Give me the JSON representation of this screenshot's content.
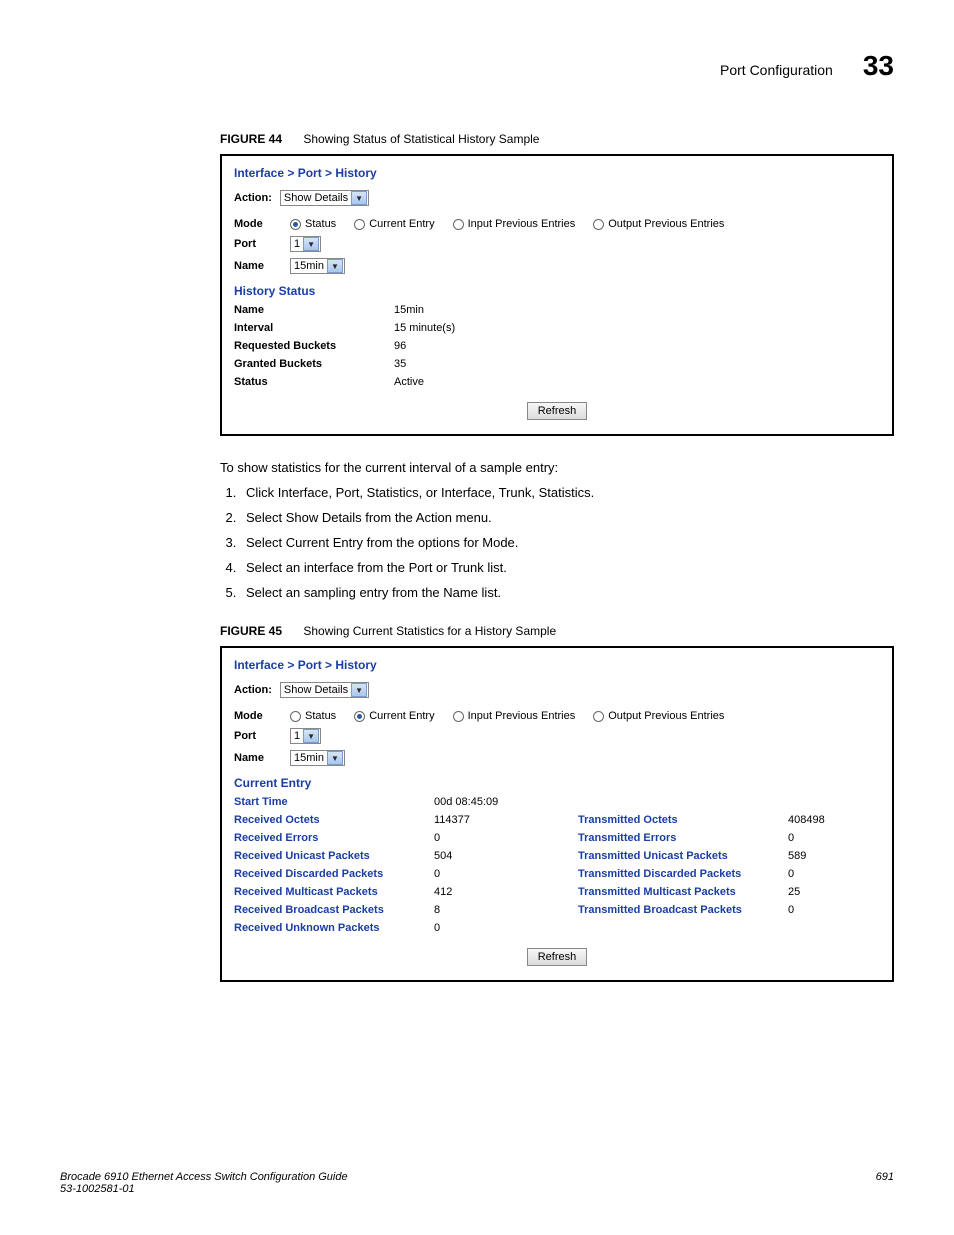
{
  "header": {
    "title": "Port Configuration",
    "chapter": "33"
  },
  "figure44": {
    "label": "FIGURE 44",
    "caption": "Showing Status of Statistical History Sample",
    "breadcrumb": "Interface > Port > History",
    "action_label": "Action:",
    "action_value": "Show Details",
    "mode_label": "Mode",
    "modes": [
      "Status",
      "Current Entry",
      "Input Previous Entries",
      "Output Previous Entries"
    ],
    "selected_mode_index": 0,
    "port_label": "Port",
    "port_value": "1",
    "name_label": "Name",
    "name_value": "15min",
    "section_head": "History Status",
    "rows": [
      {
        "k": "Name",
        "v": "15min"
      },
      {
        "k": "Interval",
        "v": "15 minute(s)"
      },
      {
        "k": "Requested Buckets",
        "v": "96"
      },
      {
        "k": "Granted Buckets",
        "v": "35"
      },
      {
        "k": "Status",
        "v": "Active"
      }
    ],
    "refresh": "Refresh"
  },
  "intro_text": "To show statistics for the current interval of a sample entry:",
  "steps": [
    "Click Interface, Port, Statistics, or Interface, Trunk, Statistics.",
    "Select Show Details from the Action menu.",
    "Select Current Entry from the options for Mode.",
    "Select an interface from the Port or Trunk list.",
    "Select an sampling entry from the Name list."
  ],
  "figure45": {
    "label": "FIGURE 45",
    "caption": "Showing Current Statistics for a History Sample",
    "breadcrumb": "Interface > Port > History",
    "action_label": "Action:",
    "action_value": "Show Details",
    "mode_label": "Mode",
    "modes": [
      "Status",
      "Current Entry",
      "Input Previous Entries",
      "Output Previous Entries"
    ],
    "selected_mode_index": 1,
    "port_label": "Port",
    "port_value": "1",
    "name_label": "Name",
    "name_value": "15min",
    "section_head": "Current Entry",
    "start_time_label": "Start Time",
    "start_time_value": "00d 08:45:09",
    "stats": [
      {
        "lk": "Received Octets",
        "lv": "114377",
        "rk": "Transmitted Octets",
        "rv": "408498"
      },
      {
        "lk": "Received Errors",
        "lv": "0",
        "rk": "Transmitted Errors",
        "rv": "0"
      },
      {
        "lk": "Received Unicast Packets",
        "lv": "504",
        "rk": "Transmitted Unicast Packets",
        "rv": "589"
      },
      {
        "lk": "Received Discarded Packets",
        "lv": "0",
        "rk": "Transmitted Discarded Packets",
        "rv": "0"
      },
      {
        "lk": "Received Multicast Packets",
        "lv": "412",
        "rk": "Transmitted Multicast Packets",
        "rv": "25"
      },
      {
        "lk": "Received Broadcast Packets",
        "lv": "8",
        "rk": "Transmitted Broadcast Packets",
        "rv": "0"
      },
      {
        "lk": "Received Unknown Packets",
        "lv": "0",
        "rk": "",
        "rv": ""
      }
    ],
    "refresh": "Refresh"
  },
  "footer": {
    "guide": "Brocade 6910 Ethernet Access Switch Configuration Guide",
    "docnum": "53-1002581-01",
    "page": "691"
  }
}
